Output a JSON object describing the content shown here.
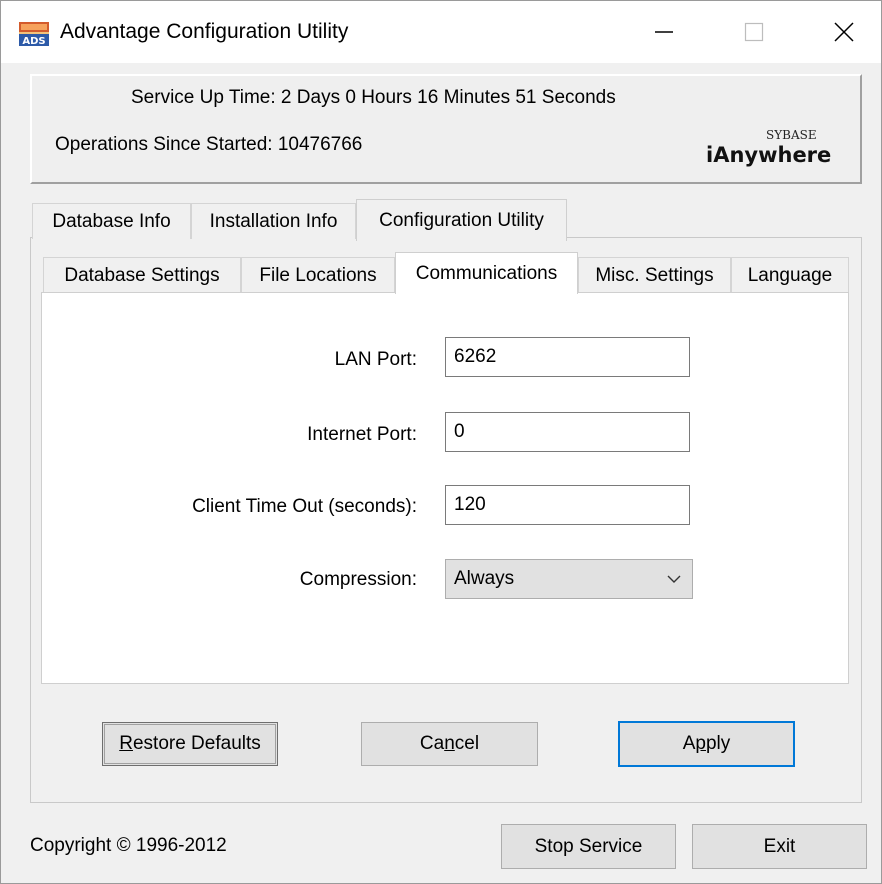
{
  "window": {
    "title": "Advantage Configuration Utility",
    "icon": "ads-app-icon",
    "controls": {
      "minimize": "minimize-icon",
      "maximize": "maximize-icon",
      "close": "close-icon"
    }
  },
  "status": {
    "uptime": "Service Up Time: 2 Days 0 Hours 16 Minutes 51 Seconds",
    "operations": "Operations Since Started: 10476766",
    "logo_top": "SYBASE",
    "logo_main": "iAnywhere"
  },
  "outer_tabs": [
    {
      "label": "Database Info",
      "selected": false
    },
    {
      "label": "Installation Info",
      "selected": false
    },
    {
      "label": "Configuration Utility",
      "selected": true
    }
  ],
  "inner_tabs": [
    {
      "label": "Database Settings",
      "selected": false
    },
    {
      "label": "File Locations",
      "selected": false
    },
    {
      "label": "Communications",
      "selected": true
    },
    {
      "label": "Misc. Settings",
      "selected": false
    },
    {
      "label": "Language",
      "selected": false
    }
  ],
  "form": {
    "lan_port_label": "LAN Port:",
    "lan_port_value": "6262",
    "internet_port_label": "Internet Port:",
    "internet_port_value": "0",
    "timeout_label": "Client Time Out (seconds):",
    "timeout_value": "120",
    "compression_label": "Compression:",
    "compression_value": "Always"
  },
  "buttons": {
    "restore_pre": "",
    "restore_accel": "R",
    "restore_post": "estore Defaults",
    "cancel_pre": "Ca",
    "cancel_accel": "n",
    "cancel_post": "cel",
    "apply_pre": "A",
    "apply_accel": "p",
    "apply_post": "ply",
    "stop_service": "Stop Service",
    "exit": "Exit"
  },
  "footer": {
    "copyright": "Copyright © 1996-2012"
  },
  "colors": {
    "accent": "#0078d7",
    "window_bg": "#f0f0f0",
    "panel_bg": "#ffffff"
  }
}
